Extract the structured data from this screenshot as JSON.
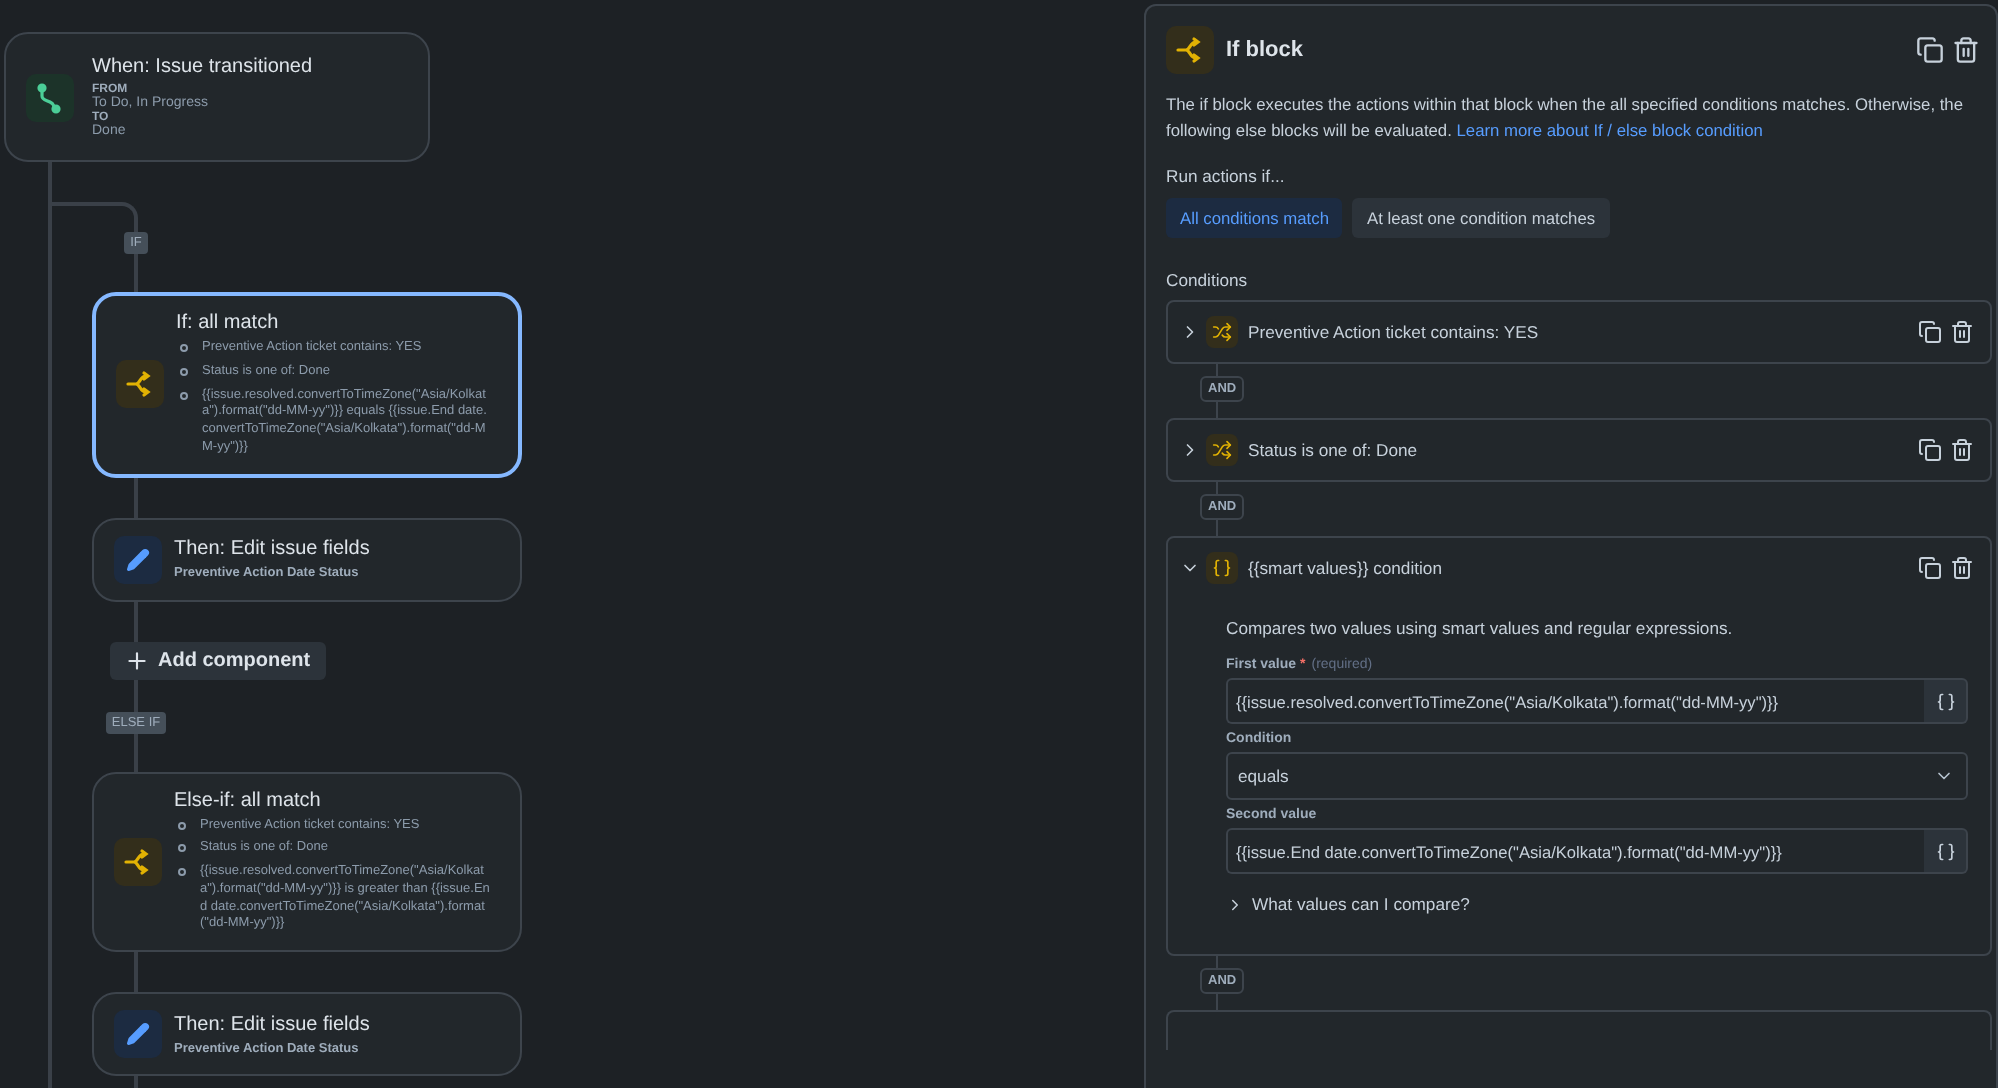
{
  "flow": {
    "trigger": {
      "title": "When: Issue transitioned",
      "fields": [
        {
          "label": "FROM",
          "value": "To Do, In Progress"
        },
        {
          "label": "TO",
          "value": "Done"
        }
      ]
    },
    "items": [
      {
        "kind": "badge",
        "label": "IF"
      },
      {
        "kind": "if_card",
        "title": "If: all match",
        "selected": true,
        "bullets": [
          "Preventive Action ticket contains: YES",
          "Status is one of: Done",
          "{{issue.resolved.convertToTimeZone(\"Asia/Kolkata\").format(\"dd-MM-yy\")}} equals {{issue.End date.convertToTimeZone(\"Asia/Kolkata\").format(\"dd-MM-yy\")}}"
        ]
      },
      {
        "kind": "action_card",
        "title": "Then: Edit issue fields",
        "subtitle": "Preventive Action Date Status",
        "selected": false
      },
      {
        "kind": "add",
        "label": "Add component"
      },
      {
        "kind": "badge",
        "label": "ELSE IF"
      },
      {
        "kind": "if_card",
        "title": "Else-if: all match",
        "selected": false,
        "bullets": [
          "Preventive Action ticket contains: YES",
          "Status is one of: Done",
          "{{issue.resolved.convertToTimeZone(\"Asia/Kolkata\").format(\"dd-MM-yy\")}} is greater than {{issue.End date.convertToTimeZone(\"Asia/Kolkata\").format(\"dd-MM-yy\")}}"
        ]
      },
      {
        "kind": "action_card",
        "title": "Then: Edit issue fields",
        "subtitle": "Preventive Action Date Status",
        "selected": false
      }
    ]
  },
  "panel": {
    "title": "If block",
    "description": "The if block executes the actions within that block when the all specified conditions matches. Otherwise, the following else blocks will be evaluated.",
    "link": "Learn more about If / else block condition",
    "run_label": "Run actions if...",
    "modes": [
      {
        "label": "All conditions match",
        "selected": true
      },
      {
        "label": "At least one condition matches",
        "selected": false
      }
    ],
    "conditions_label": "Conditions",
    "conditions": [
      {
        "kind": "field_condition",
        "title": "Preventive Action ticket contains: YES",
        "expanded": false,
        "joiner": "AND"
      },
      {
        "kind": "field_condition",
        "title": "Status is one of: Done",
        "expanded": false,
        "joiner": "AND"
      },
      {
        "kind": "smart_condition",
        "title": "{{smart values}} condition",
        "expanded": true,
        "joiner": "AND",
        "details": {
          "description": "Compares two values using smart values and regular expressions.",
          "fields": [
            {
              "kind": "text",
              "label": "First value",
              "required": "*",
              "hint": "(required)",
              "value": "{{issue.resolved.convertToTimeZone(\"Asia/Kolkata\").format(\"dd-MM-yy\")}}"
            },
            {
              "kind": "select",
              "label": "Condition",
              "value": "equals"
            },
            {
              "kind": "text",
              "label": "Second value",
              "value": "{{issue.End date.convertToTimeZone(\"Asia/Kolkata\").format(\"dd-MM-yy\")}}"
            }
          ],
          "more": "What values can I compare?"
        }
      }
    ]
  }
}
